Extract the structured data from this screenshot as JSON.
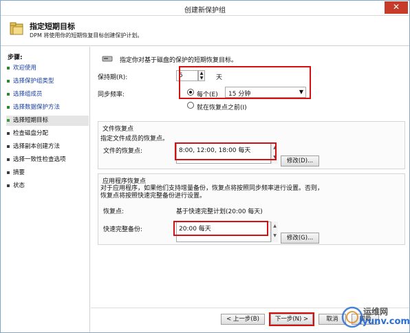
{
  "window": {
    "title": "创建新保护组",
    "close_glyph": "✕"
  },
  "header": {
    "title": "指定短期目标",
    "description": "DPM 将使用你的短期恢复目标创建保护计划。"
  },
  "sidebar": {
    "label": "步骤:",
    "items": [
      {
        "label": "欢迎使用",
        "state": "done"
      },
      {
        "label": "选择保护组类型",
        "state": "done"
      },
      {
        "label": "选择组成员",
        "state": "done"
      },
      {
        "label": "选择数据保护方法",
        "state": "done"
      },
      {
        "label": "选择短期目标",
        "state": "active"
      },
      {
        "label": "检查磁盘分配",
        "state": "todo"
      },
      {
        "label": "选择副本创建方法",
        "state": "todo"
      },
      {
        "label": "选择一致性检查选项",
        "state": "todo"
      },
      {
        "label": "摘要",
        "state": "todo"
      },
      {
        "label": "状态",
        "state": "todo"
      }
    ]
  },
  "main": {
    "intro": "指定你对基于磁盘的保护的短期恢复目标。",
    "retention": {
      "label": "保持期(R):",
      "value": "5",
      "unit": "天"
    },
    "sync": {
      "label": "同步频率:",
      "option_every": "每个(E)",
      "every_value": "15 分钟",
      "option_before": "就在恢复点之前(I)",
      "selected": "every"
    },
    "file_recovery": {
      "group_title": "文件恢复点",
      "desc": "指定文件成员的恢复点。",
      "label": "文件的恢复点:",
      "value": "8:00,  12:00,  18:00 每天",
      "modify_button": "修改(D)..."
    },
    "app_recovery": {
      "group_title": "应用程序恢复点",
      "desc": "对于应用程序，如果他们支持增量备份，恢复点将按照同步频率进行设置。否则，恢复点将按照快速完整备份进行设置。",
      "recovery_label": "恢复点:",
      "recovery_value": "基于快速完整计划(20:00 每天)",
      "fast_full_label": "快速完整备份:",
      "fast_full_value": "20:00 每天",
      "modify_button": "修改(G)..."
    }
  },
  "footer": {
    "back": "< 上一步(B)",
    "next": "下一步(N) >",
    "cancel": "取消",
    "help": "帮助"
  },
  "watermark": {
    "brand": "运维网",
    "url": "iyunv.com"
  },
  "colors": {
    "highlight": "#d61010",
    "link": "#1a3fa8",
    "done_dot": "#2a8a2a"
  }
}
